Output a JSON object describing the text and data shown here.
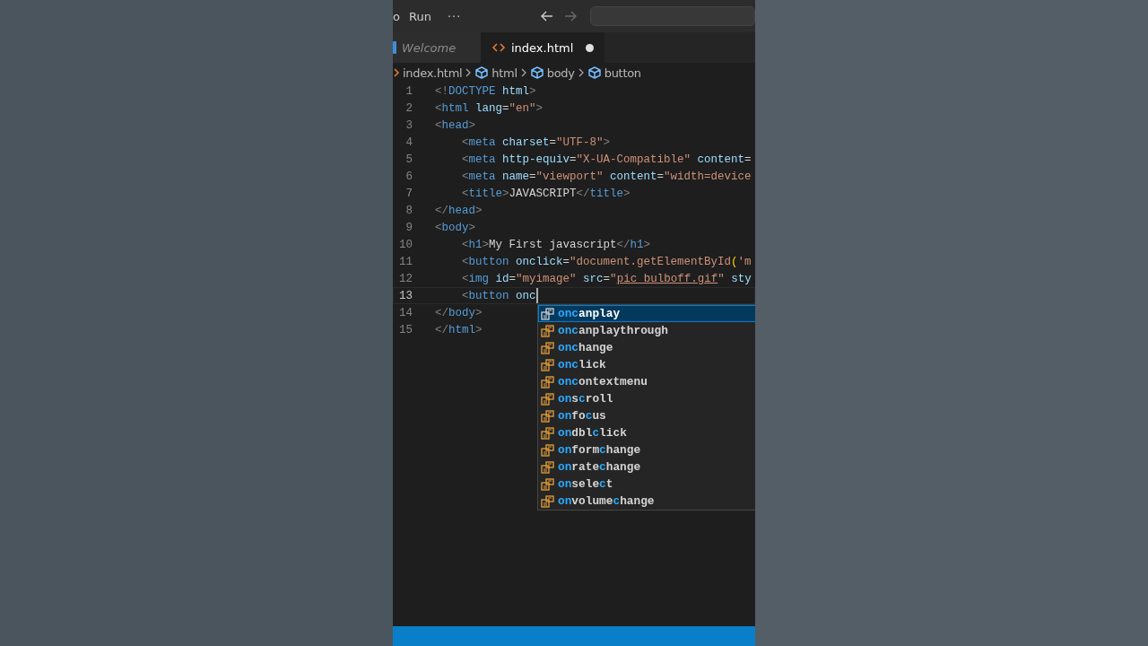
{
  "title_bar": {
    "menus": [
      {
        "kind": "menu",
        "label": "o"
      },
      {
        "kind": "menu",
        "label": "Run"
      },
      {
        "kind": "more",
        "label": "···"
      }
    ],
    "nav": [
      {
        "kind": "back",
        "disabled": false
      },
      {
        "kind": "forward",
        "disabled": true
      }
    ]
  },
  "tabs": [
    {
      "label": "Welcome",
      "kind": "welcome",
      "selected": false,
      "modified": false
    },
    {
      "label": "index.html",
      "kind": "html",
      "selected": true,
      "modified": true
    }
  ],
  "breadcrumb": [
    {
      "kind": "file",
      "label": "index.html"
    },
    {
      "kind": "element",
      "label": "html"
    },
    {
      "kind": "element",
      "label": "body"
    },
    {
      "kind": "element",
      "label": "button"
    }
  ],
  "editor": {
    "lines": [
      {
        "number": "1",
        "current": false,
        "tokens": [
          {
            "kind": "punct",
            "text": "<!"
          },
          {
            "kind": "tag",
            "text": "DOCTYPE"
          },
          {
            "kind": "attr",
            "text": " html"
          },
          {
            "kind": "punct",
            "text": ">"
          }
        ]
      },
      {
        "number": "2",
        "current": false,
        "tokens": [
          {
            "kind": "punct",
            "text": "<"
          },
          {
            "kind": "tag",
            "text": "html"
          },
          {
            "kind": "attr",
            "text": " lang"
          },
          {
            "kind": "text",
            "text": "="
          },
          {
            "kind": "string",
            "text": "\"en\""
          },
          {
            "kind": "punct",
            "text": ">"
          }
        ]
      },
      {
        "number": "3",
        "current": false,
        "tokens": [
          {
            "kind": "punct",
            "text": "<"
          },
          {
            "kind": "tag",
            "text": "head"
          },
          {
            "kind": "punct",
            "text": ">"
          }
        ]
      },
      {
        "number": "4",
        "current": false,
        "tokens": [
          {
            "kind": "punct",
            "text": "    <"
          },
          {
            "kind": "tag",
            "text": "meta"
          },
          {
            "kind": "attr",
            "text": " charset"
          },
          {
            "kind": "text",
            "text": "="
          },
          {
            "kind": "string",
            "text": "\"UTF-8\""
          },
          {
            "kind": "punct",
            "text": ">"
          }
        ]
      },
      {
        "number": "5",
        "current": false,
        "tokens": [
          {
            "kind": "punct",
            "text": "    <"
          },
          {
            "kind": "tag",
            "text": "meta"
          },
          {
            "kind": "attr",
            "text": " http-equiv"
          },
          {
            "kind": "text",
            "text": "="
          },
          {
            "kind": "string",
            "text": "\"X-UA-Compatible\""
          },
          {
            "kind": "attr",
            "text": " content"
          },
          {
            "kind": "text",
            "text": "="
          }
        ]
      },
      {
        "number": "6",
        "current": false,
        "tokens": [
          {
            "kind": "punct",
            "text": "    <"
          },
          {
            "kind": "tag",
            "text": "meta"
          },
          {
            "kind": "attr",
            "text": " name"
          },
          {
            "kind": "text",
            "text": "="
          },
          {
            "kind": "string",
            "text": "\"viewport\""
          },
          {
            "kind": "attr",
            "text": " content"
          },
          {
            "kind": "text",
            "text": "="
          },
          {
            "kind": "string",
            "text": "\"width=device"
          }
        ]
      },
      {
        "number": "7",
        "current": false,
        "tokens": [
          {
            "kind": "punct",
            "text": "    <"
          },
          {
            "kind": "tag",
            "text": "title"
          },
          {
            "kind": "punct",
            "text": ">"
          },
          {
            "kind": "text",
            "text": "JAVASCRIPT"
          },
          {
            "kind": "punct",
            "text": "</"
          },
          {
            "kind": "tag",
            "text": "title"
          },
          {
            "kind": "punct",
            "text": ">"
          }
        ]
      },
      {
        "number": "8",
        "current": false,
        "tokens": [
          {
            "kind": "punct",
            "text": "</"
          },
          {
            "kind": "tag",
            "text": "head"
          },
          {
            "kind": "punct",
            "text": ">"
          }
        ]
      },
      {
        "number": "9",
        "current": false,
        "tokens": [
          {
            "kind": "punct",
            "text": "<"
          },
          {
            "kind": "tag",
            "text": "body"
          },
          {
            "kind": "punct",
            "text": ">"
          }
        ]
      },
      {
        "number": "10",
        "current": false,
        "tokens": [
          {
            "kind": "punct",
            "text": "    <"
          },
          {
            "kind": "tag",
            "text": "h1"
          },
          {
            "kind": "punct",
            "text": ">"
          },
          {
            "kind": "text",
            "text": "My First javascript"
          },
          {
            "kind": "punct",
            "text": "</"
          },
          {
            "kind": "tag",
            "text": "h1"
          },
          {
            "kind": "punct",
            "text": ">"
          }
        ]
      },
      {
        "number": "11",
        "current": false,
        "tokens": [
          {
            "kind": "punct",
            "text": "    <"
          },
          {
            "kind": "tag",
            "text": "button"
          },
          {
            "kind": "attr",
            "text": " onclick"
          },
          {
            "kind": "text",
            "text": "="
          },
          {
            "kind": "string",
            "text": "\"document.getElementById"
          },
          {
            "kind": "bracket",
            "text": "("
          },
          {
            "kind": "string",
            "text": "'m"
          }
        ]
      },
      {
        "number": "12",
        "current": false,
        "tokens": [
          {
            "kind": "punct",
            "text": "    <"
          },
          {
            "kind": "tag",
            "text": "img"
          },
          {
            "kind": "attr",
            "text": " id"
          },
          {
            "kind": "text",
            "text": "="
          },
          {
            "kind": "string",
            "text": "\"myimage\""
          },
          {
            "kind": "attr",
            "text": " src"
          },
          {
            "kind": "text",
            "text": "="
          },
          {
            "kind": "string",
            "text": "\""
          },
          {
            "kind": "link",
            "text": "pic_bulboff.gif"
          },
          {
            "kind": "string",
            "text": "\""
          },
          {
            "kind": "attr",
            "text": " sty"
          }
        ]
      },
      {
        "number": "13",
        "current": true,
        "tokens": [
          {
            "kind": "punct",
            "text": "    <"
          },
          {
            "kind": "tag",
            "text": "button"
          },
          {
            "kind": "attr",
            "text": " onc"
          }
        ]
      },
      {
        "number": "14",
        "current": false,
        "tokens": [
          {
            "kind": "punct",
            "text": "</"
          },
          {
            "kind": "tag",
            "text": "body"
          },
          {
            "kind": "punct",
            "text": ">"
          }
        ]
      },
      {
        "number": "15",
        "current": false,
        "tokens": [
          {
            "kind": "punct",
            "text": "</"
          },
          {
            "kind": "tag",
            "text": "html"
          },
          {
            "kind": "punct",
            "text": ">"
          }
        ]
      }
    ]
  },
  "suggestions": [
    {
      "selected": true,
      "parts": [
        {
          "text": "onc",
          "match": true
        },
        {
          "text": "anplay",
          "match": false
        }
      ]
    },
    {
      "selected": false,
      "parts": [
        {
          "text": "onc",
          "match": true
        },
        {
          "text": "anplaythrough",
          "match": false
        }
      ]
    },
    {
      "selected": false,
      "parts": [
        {
          "text": "onc",
          "match": true
        },
        {
          "text": "hange",
          "match": false
        }
      ]
    },
    {
      "selected": false,
      "parts": [
        {
          "text": "onc",
          "match": true
        },
        {
          "text": "lick",
          "match": false
        }
      ]
    },
    {
      "selected": false,
      "parts": [
        {
          "text": "onc",
          "match": true
        },
        {
          "text": "ontextmenu",
          "match": false
        }
      ]
    },
    {
      "selected": false,
      "parts": [
        {
          "text": "on",
          "match": true
        },
        {
          "text": "s",
          "match": false
        },
        {
          "text": "c",
          "match": true
        },
        {
          "text": "roll",
          "match": false
        }
      ]
    },
    {
      "selected": false,
      "parts": [
        {
          "text": "on",
          "match": true
        },
        {
          "text": "fo",
          "match": false
        },
        {
          "text": "c",
          "match": true
        },
        {
          "text": "us",
          "match": false
        }
      ]
    },
    {
      "selected": false,
      "parts": [
        {
          "text": "on",
          "match": true
        },
        {
          "text": "dbl",
          "match": false
        },
        {
          "text": "c",
          "match": true
        },
        {
          "text": "lick",
          "match": false
        }
      ]
    },
    {
      "selected": false,
      "parts": [
        {
          "text": "on",
          "match": true
        },
        {
          "text": "form",
          "match": false
        },
        {
          "text": "c",
          "match": true
        },
        {
          "text": "hange",
          "match": false
        }
      ]
    },
    {
      "selected": false,
      "parts": [
        {
          "text": "on",
          "match": true
        },
        {
          "text": "rate",
          "match": false
        },
        {
          "text": "c",
          "match": true
        },
        {
          "text": "hange",
          "match": false
        }
      ]
    },
    {
      "selected": false,
      "parts": [
        {
          "text": "on",
          "match": true
        },
        {
          "text": "sele",
          "match": false
        },
        {
          "text": "c",
          "match": true
        },
        {
          "text": "t",
          "match": false
        }
      ]
    },
    {
      "selected": false,
      "parts": [
        {
          "text": "on",
          "match": true
        },
        {
          "text": "volume",
          "match": false
        },
        {
          "text": "c",
          "match": true
        },
        {
          "text": "hange",
          "match": false
        }
      ]
    }
  ]
}
